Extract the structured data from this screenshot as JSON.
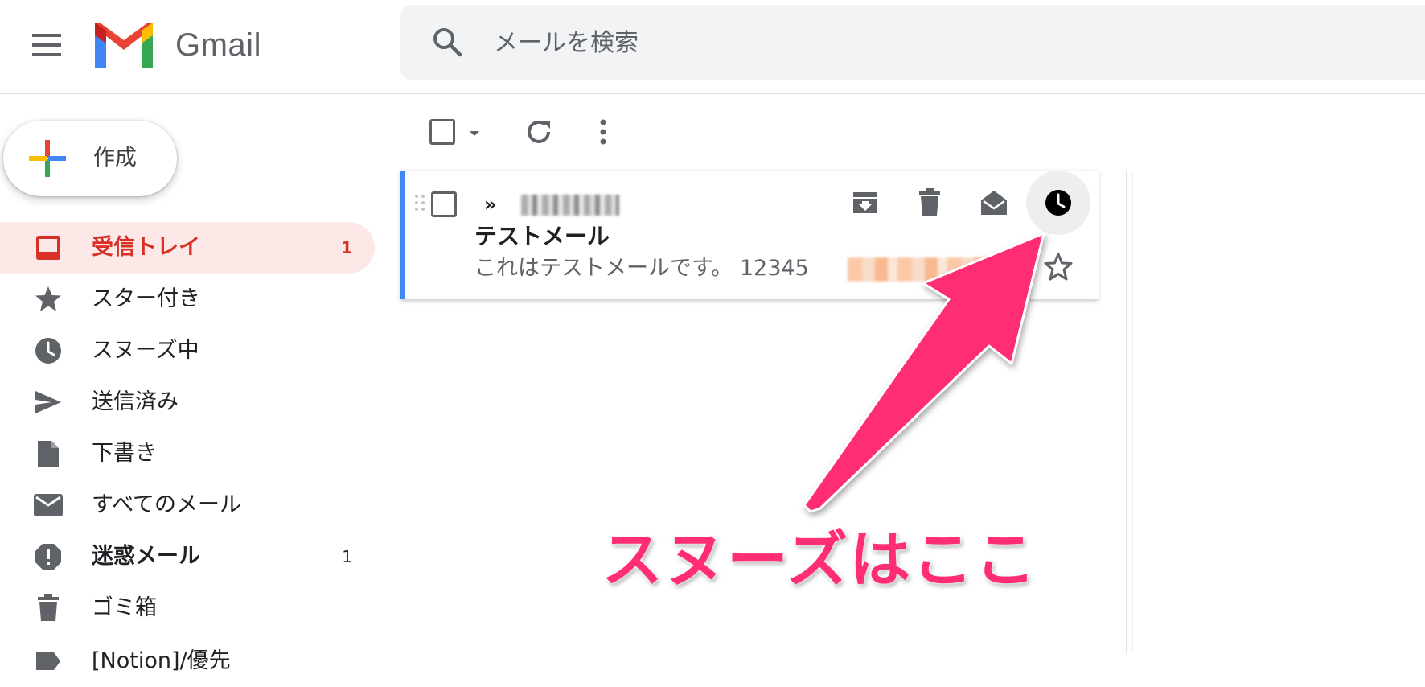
{
  "header": {
    "app_name": "Gmail",
    "search_placeholder": "メールを検索"
  },
  "compose": {
    "label": "作成"
  },
  "sidebar": {
    "items": [
      {
        "label": "受信トレイ",
        "count": "1",
        "icon": "inbox-icon",
        "active": true
      },
      {
        "label": "スター付き",
        "count": "",
        "icon": "star-icon"
      },
      {
        "label": "スヌーズ中",
        "count": "",
        "icon": "clock-icon"
      },
      {
        "label": "送信済み",
        "count": "",
        "icon": "send-icon"
      },
      {
        "label": "下書き",
        "count": "",
        "icon": "draft-icon"
      },
      {
        "label": "すべてのメール",
        "count": "",
        "icon": "mail-icon"
      },
      {
        "label": "迷惑メール",
        "count": "1",
        "icon": "spam-icon",
        "bold": true
      },
      {
        "label": "ゴミ箱",
        "count": "",
        "icon": "trash-icon"
      },
      {
        "label": "[Notion]/優先",
        "count": "",
        "icon": "label-icon"
      }
    ]
  },
  "email": {
    "importance_marker": "»",
    "subject": "テストメール",
    "snippet": "これはテストメールです。 12345"
  },
  "annotation": {
    "text": "スヌーズはここ",
    "color": "#ff2d73"
  },
  "colors": {
    "active_bg": "#fce8e6",
    "active_text": "#d93025",
    "row_accent": "#4285f4"
  }
}
